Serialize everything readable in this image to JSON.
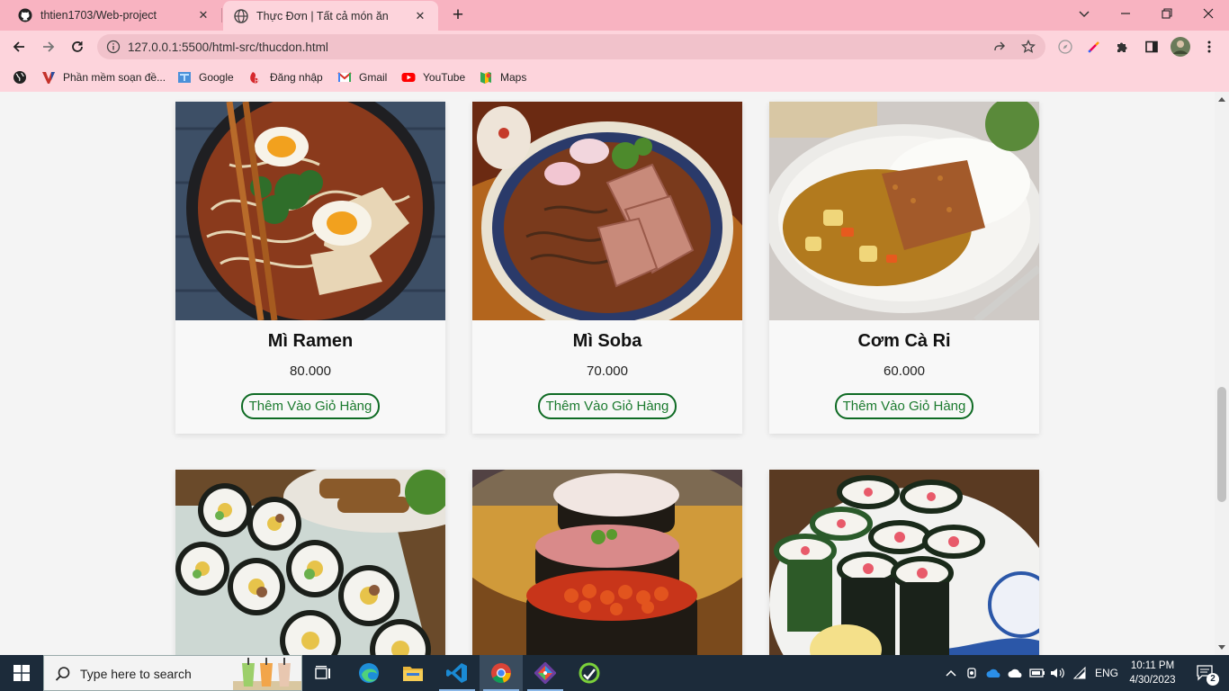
{
  "browser": {
    "tabs": [
      {
        "title": "thtien1703/Web-project",
        "favicon": "github-icon"
      },
      {
        "title": "Thực Đơn | Tất cả món ăn",
        "favicon": "globe-icon"
      }
    ],
    "url": "127.0.0.1:5500/html-src/thucdon.html",
    "bookmarks": [
      {
        "label": "Phần mềm soạn đề...",
        "icon": "v-logo-icon"
      },
      {
        "label": "Google",
        "icon": "google-icon"
      },
      {
        "label": "Đăng nhập",
        "icon": "login-icon"
      },
      {
        "label": "Gmail",
        "icon": "gmail-icon"
      },
      {
        "label": "YouTube",
        "icon": "youtube-icon"
      },
      {
        "label": "Maps",
        "icon": "maps-icon"
      }
    ]
  },
  "menu": {
    "cart_button_label": "Thêm Vào Giỏ Hàng",
    "items": [
      {
        "name": "Mì Ramen",
        "price": "80.000"
      },
      {
        "name": "Mì Soba",
        "price": "70.000"
      },
      {
        "name": "Cơm Cà Ri",
        "price": "60.000"
      },
      {
        "name": "",
        "price": ""
      },
      {
        "name": "",
        "price": ""
      },
      {
        "name": "",
        "price": ""
      }
    ]
  },
  "taskbar": {
    "search_placeholder": "Type here to search",
    "language": "ENG",
    "time": "10:11 PM",
    "date": "4/30/2023",
    "notification_count": "2"
  },
  "colors": {
    "tabstrip": "#f8b3c1",
    "toolbar": "#fdd4dc",
    "cart_button_border": "#0f6b24",
    "cart_button_text": "#1b7a2e",
    "taskbar": "#1c2b3a"
  }
}
